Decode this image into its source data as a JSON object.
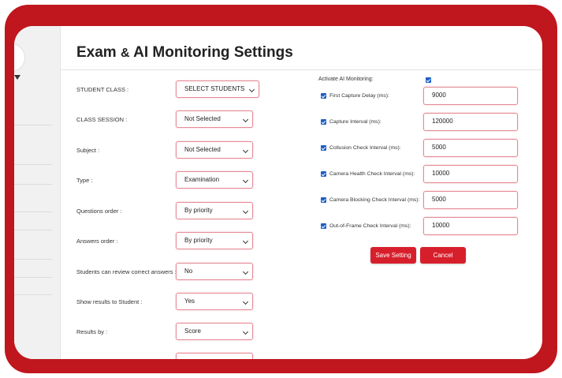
{
  "page": {
    "title_part1": "Exam",
    "title_amp": "&",
    "title_part2": "AI Monitoring Settings"
  },
  "sidebar": {
    "brand_text": "···"
  },
  "left_form": [
    {
      "label": "STUDENT CLASS :",
      "value": "SELECT STUDENTS"
    },
    {
      "label": "CLASS SESSION :",
      "value": "Not Selected"
    },
    {
      "label": "Subject :",
      "value": "Not Selected"
    },
    {
      "label": "Type :",
      "value": "Examination"
    },
    {
      "label": "Questions order :",
      "value": "By priority"
    },
    {
      "label": "Answers order :",
      "value": "By priority"
    },
    {
      "label": "Students can review correct answers :",
      "value": "No"
    },
    {
      "label": "Show results to Student :",
      "value": "Yes"
    },
    {
      "label": "Results by :",
      "value": "Score"
    }
  ],
  "ai_monitoring": {
    "activate_label": "Activate AI Monitoring:",
    "activate_checked": true,
    "fields": [
      {
        "label": "First Capture Delay (ms):",
        "value": "9000",
        "checked": true
      },
      {
        "label": "Capture Interval (ms):",
        "value": "120000",
        "checked": true
      },
      {
        "label": "Collusion Check Interval (ms):",
        "value": "5000",
        "checked": true
      },
      {
        "label": "Camera Health Check Interval (ms):",
        "value": "10000",
        "checked": true
      },
      {
        "label": "Camera Blocking Check Interval (ms):",
        "value": "5000",
        "checked": true
      },
      {
        "label": "Out-of-Frame Check Interval (ms):",
        "value": "10000",
        "checked": true
      }
    ]
  },
  "buttons": {
    "save": "Save Setting",
    "cancel": "Cancel"
  },
  "colors": {
    "frame": "#c0161d",
    "button": "#d71f2c",
    "field_border": "#e58a96",
    "checkbox": "#1e5fc4"
  }
}
